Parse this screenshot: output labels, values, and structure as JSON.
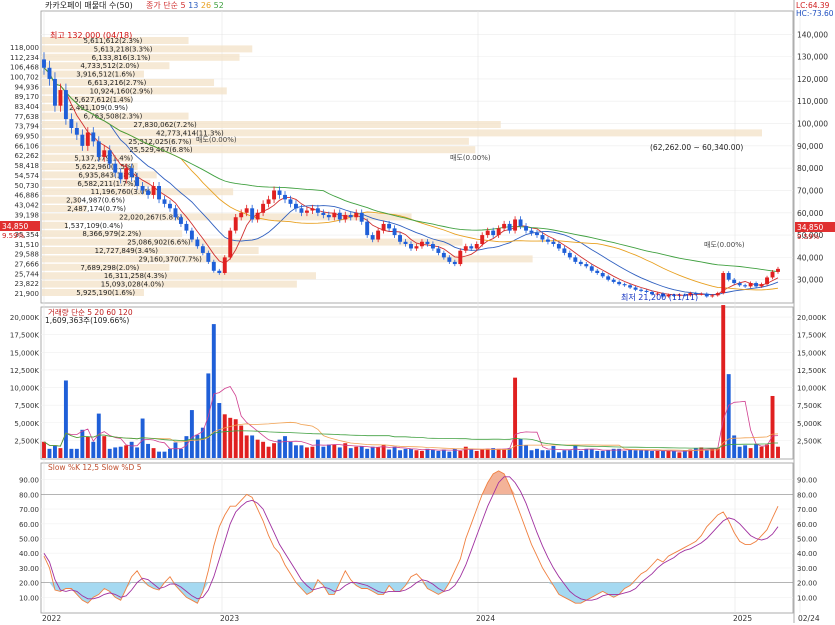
{
  "chart_data": [
    {
      "type": "candlestick",
      "title": "카카오페이 매물대 수(50)",
      "legend": [
        "종가 단순 5",
        "13",
        "26",
        "52"
      ],
      "legend_colors": [
        "#d03030",
        "#3060c0",
        "#e8a020",
        "#40a040"
      ],
      "ylim": [
        20000,
        150000
      ],
      "y_ticks_right": [
        140000,
        130000,
        120000,
        110000,
        100000,
        90000,
        80000,
        70000,
        60000,
        50000,
        40000,
        30000
      ],
      "y_ticks_left": [
        "118,000",
        "112,234",
        "106,468",
        "100,702",
        "94,936",
        "89,170",
        "83,404",
        "77,638",
        "73,794",
        "69,950",
        "66,106",
        "62,262",
        "58,418",
        "54,574",
        "50,730",
        "46,886",
        "43,042",
        "39,198",
        "37,276",
        "35,354",
        "31,510",
        "29,588",
        "27,666",
        "25,744",
        "23,822",
        "21,900"
      ],
      "current_price": "34,850",
      "current_change": "9.59%",
      "lc_label": "LC:64.39",
      "hc_label": "HC:-73.60",
      "high_note": "최고 132,000 (04/18)",
      "low_note": "최저 21,200 (11/11)",
      "x_labels": [
        "2022",
        "2023",
        "2024",
        "2025",
        "02/24"
      ],
      "weekly_close": [
        125000,
        120000,
        108000,
        115000,
        102000,
        98000,
        95000,
        90000,
        96000,
        92000,
        85000,
        88000,
        82000,
        78000,
        75000,
        80000,
        76000,
        72000,
        70000,
        68000,
        72000,
        66000,
        64000,
        62000,
        58000,
        55000,
        52000,
        48000,
        45000,
        42000,
        38000,
        34000,
        33000,
        40000,
        52000,
        58000,
        60000,
        62000,
        57000,
        60000,
        64000,
        66000,
        70000,
        68000,
        66000,
        64000,
        62000,
        60000,
        61000,
        62000,
        60000,
        59000,
        58000,
        60000,
        57000,
        59000,
        58000,
        60000,
        56000,
        50000,
        48000,
        52000,
        55000,
        53000,
        50000,
        47000,
        46000,
        44000,
        45000,
        47000,
        46000,
        44000,
        42000,
        40000,
        38000,
        37000,
        43000,
        45000,
        44000,
        46000,
        50000,
        52000,
        50000,
        53000,
        55000,
        52000,
        57000,
        54000,
        52000,
        51000,
        50000,
        48000,
        47000,
        46000,
        44000,
        42000,
        40000,
        38000,
        37000,
        36000,
        34000,
        33000,
        31500,
        30000,
        29000,
        28000,
        27500,
        26500,
        25500,
        25000,
        24500,
        23500,
        23800,
        22500,
        23200,
        22800,
        23300,
        23000,
        24000,
        23500,
        23700,
        22500,
        23000,
        24000,
        33000,
        30000,
        28500,
        27500,
        27000,
        28500,
        27000,
        28000,
        31000,
        33500,
        34850
      ],
      "volume_title": "거래량 단순 5 20 60 120",
      "volume_value": "1,609,363주(109.66%)",
      "volume_ticks": [
        "20,000K",
        "17,500K",
        "15,000K",
        "12,500K",
        "10,000K",
        "7,500K",
        "5,000K",
        "2,500K"
      ],
      "volume_max_k": 21000,
      "volume_k": [
        2300,
        1300,
        1700,
        1400,
        11000,
        1300,
        1300,
        4000,
        3000,
        2300,
        6300,
        3100,
        1300,
        1500,
        1600,
        1800,
        2300,
        1500,
        5600,
        2000,
        1400,
        900,
        900,
        1300,
        2200,
        1300,
        3100,
        6800,
        3300,
        4300,
        12000,
        19000,
        7800,
        6200,
        5700,
        5500,
        4600,
        3200,
        3200,
        2600,
        2300,
        1600,
        2100,
        2600,
        3100,
        2300,
        1800,
        1800,
        1500,
        1600,
        2600,
        1600,
        1900,
        1900,
        1500,
        2100,
        1400,
        1600,
        1700,
        1300,
        1600,
        1500,
        1900,
        1200,
        1600,
        1100,
        1300,
        1300,
        1100,
        1000,
        1300,
        1200,
        1000,
        1200,
        900,
        1300,
        1000,
        1600,
        1300,
        1000,
        1200,
        1300,
        1400,
        1300,
        1200,
        1400,
        11400,
        2700,
        1800,
        1100,
        1300,
        1100,
        1100,
        1700,
        800,
        1100,
        1100,
        1800,
        1000,
        1300,
        1200,
        1000,
        1000,
        1100,
        1300,
        1300,
        1000,
        1200,
        1100,
        1100,
        1100,
        1000,
        1000,
        1000,
        1000,
        1000,
        800,
        1100,
        1200,
        1400,
        1500,
        1100,
        1300,
        1400,
        21700,
        11900,
        3200,
        1600,
        1800,
        1400,
        2000,
        1600,
        1900,
        8800,
        1600
      ],
      "stoch_title": "Slow %K 12,5 Slow %D 5",
      "stoch_ticks": [
        "90.00",
        "80.00",
        "70.00",
        "60.00",
        "50.00",
        "40.00",
        "30.00",
        "20.00",
        "10.00"
      ],
      "stoch_k": [
        38,
        30,
        15,
        14,
        16,
        16,
        12,
        8,
        6,
        10,
        12,
        16,
        14,
        10,
        8,
        16,
        24,
        28,
        22,
        18,
        16,
        15,
        20,
        24,
        18,
        14,
        10,
        8,
        6,
        14,
        28,
        45,
        58,
        66,
        72,
        72,
        76,
        80,
        78,
        70,
        62,
        52,
        44,
        40,
        32,
        26,
        20,
        16,
        12,
        14,
        22,
        18,
        12,
        12,
        20,
        28,
        22,
        18,
        16,
        16,
        14,
        12,
        12,
        18,
        14,
        14,
        18,
        24,
        26,
        22,
        16,
        14,
        12,
        14,
        20,
        28,
        36,
        50,
        60,
        70,
        80,
        88,
        94,
        96,
        94,
        86,
        76,
        66,
        56,
        46,
        38,
        30,
        24,
        18,
        12,
        10,
        8,
        6,
        6,
        8,
        10,
        12,
        14,
        12,
        10,
        12,
        16,
        18,
        22,
        26,
        28,
        32,
        36,
        34,
        38,
        40,
        42,
        44,
        46,
        48,
        52,
        58,
        62,
        66,
        68,
        62,
        54,
        48,
        46,
        46,
        48,
        52,
        56,
        64,
        72
      ],
      "stoch_d": [
        40,
        34,
        22,
        15,
        14,
        15,
        14,
        11,
        9,
        9,
        10,
        12,
        13,
        12,
        10,
        11,
        15,
        20,
        23,
        22,
        19,
        16,
        17,
        19,
        19,
        17,
        14,
        11,
        9,
        10,
        15,
        24,
        36,
        48,
        60,
        68,
        72,
        75,
        76,
        74,
        70,
        62,
        54,
        46,
        40,
        34,
        28,
        22,
        18,
        15,
        16,
        17,
        16,
        14,
        15,
        18,
        20,
        20,
        19,
        18,
        16,
        14,
        13,
        14,
        14,
        14,
        15,
        17,
        20,
        22,
        21,
        19,
        16,
        14,
        15,
        18,
        24,
        32,
        42,
        52,
        62,
        72,
        80,
        88,
        92,
        92,
        88,
        82,
        74,
        64,
        54,
        45,
        37,
        30,
        24,
        19,
        14,
        11,
        9,
        8,
        8,
        9,
        11,
        12,
        12,
        12,
        13,
        14,
        16,
        20,
        23,
        26,
        30,
        33,
        35,
        37,
        40,
        42,
        43,
        45,
        47,
        50,
        54,
        58,
        62,
        64,
        63,
        60,
        56,
        52,
        50,
        49,
        50,
        53,
        58
      ]
    }
  ],
  "volume_profile": [
    {
      "label": "5,611,612(2.3%)"
    },
    {
      "label": "5,613,218(3.3%)"
    },
    {
      "label": "6,133,816(3.1%)"
    },
    {
      "label": "4,733,512(2.0%)"
    },
    {
      "label": "3,916,512(1.6%)"
    },
    {
      "label": "6,613,216(2.7%)"
    },
    {
      "label": "10,924,160(2.9%)"
    },
    {
      "label": "5,627,612(1.4%)"
    },
    {
      "label": "2,491,109(0.9%)"
    },
    {
      "label": "6,763,508(2.3%)"
    },
    {
      "label": "27,830,062(7.2%)"
    },
    {
      "label": "42,773,414(11.3%)"
    },
    {
      "label": "25,312,025(6.7%)"
    },
    {
      "label": "25,529,467(6.8%)"
    },
    {
      "label": "5,137,379(1.4%)"
    },
    {
      "label": "5,622,960(1.5%)"
    },
    {
      "label": "6,935,843(1.8%)"
    },
    {
      "label": "6,582,211(1.7%)"
    },
    {
      "label": "11,196,760(3.0%)"
    },
    {
      "label": "2,304,987(0.6%)"
    },
    {
      "label": "2,487,174(0.7%)"
    },
    {
      "label": "22,020,267(5.8%)"
    },
    {
      "label": "1,537,109(0.4%)"
    },
    {
      "label": "8,366,979(2.2%)"
    },
    {
      "label": "25,086,902(6.6%)"
    },
    {
      "label": "12,727,849(3.4%)"
    },
    {
      "label": "29,160,370(7.7%)"
    },
    {
      "label": "7,689,298(2.0%)"
    },
    {
      "label": "16,311,258(4.3%)"
    },
    {
      "label": "15,093,028(4.0%)"
    },
    {
      "label": "5,925,190(1.6%)"
    }
  ],
  "annotations": [
    "(62,262.00 ~ 60,340.00)",
    "매도(0.00%)",
    "매도(0.00%)",
    "매도(0.00%)"
  ]
}
